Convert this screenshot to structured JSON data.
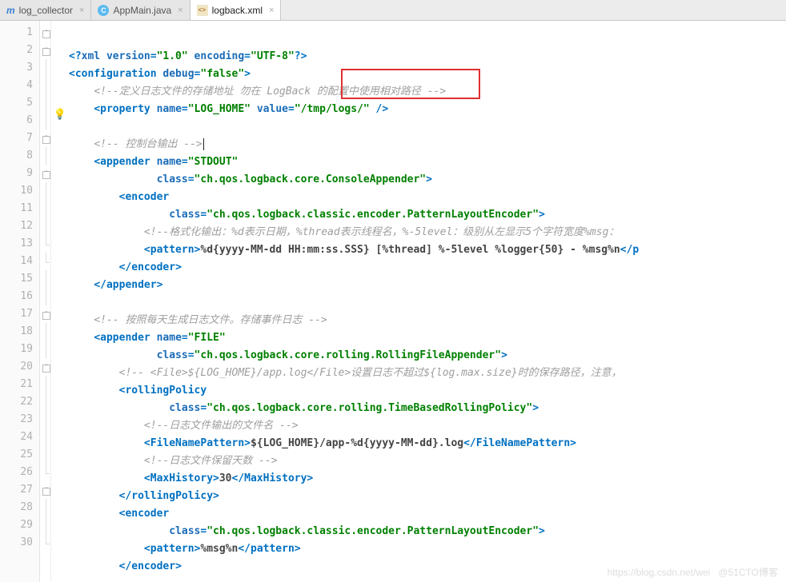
{
  "tabs": [
    {
      "icon": "m",
      "label": "log_collector",
      "active": false
    },
    {
      "icon": "j",
      "label": "AppMain.java",
      "active": false
    },
    {
      "icon": "x",
      "label": "logback.xml",
      "active": true
    }
  ],
  "highlight_value": "\"/tmp/logs/\"",
  "code": [
    {
      "n": "1",
      "fold": "top",
      "bulb": "",
      "spans": [
        {
          "c": "tag",
          "t": "<?"
        },
        {
          "c": "attr",
          "t": "xml version"
        },
        {
          "c": "tag",
          "t": "="
        },
        {
          "c": "str",
          "t": "\"1.0\""
        },
        {
          "c": "tag",
          "t": " "
        },
        {
          "c": "attr",
          "t": "encoding"
        },
        {
          "c": "tag",
          "t": "="
        },
        {
          "c": "str",
          "t": "\"UTF-8\""
        },
        {
          "c": "tag",
          "t": "?>"
        }
      ]
    },
    {
      "n": "2",
      "fold": "top",
      "bulb": "",
      "spans": [
        {
          "c": "tag",
          "t": "<configuration "
        },
        {
          "c": "attr",
          "t": "debug"
        },
        {
          "c": "tag",
          "t": "="
        },
        {
          "c": "str",
          "t": "\"false\""
        },
        {
          "c": "tag",
          "t": ">"
        }
      ]
    },
    {
      "n": "3",
      "fold": "line",
      "bulb": "",
      "spans": [
        {
          "c": "",
          "t": "    "
        },
        {
          "c": "cmt",
          "t": "<!--定义日志文件的存储地址 勿在 LogBack 的配置中使用相对路径 -->"
        }
      ]
    },
    {
      "n": "4",
      "fold": "line",
      "bulb": "",
      "spans": [
        {
          "c": "",
          "t": "    "
        },
        {
          "c": "tag",
          "t": "<property "
        },
        {
          "c": "attr",
          "t": "name"
        },
        {
          "c": "tag",
          "t": "="
        },
        {
          "c": "str",
          "t": "\"LOG_HOME\""
        },
        {
          "c": "tag",
          "t": " "
        },
        {
          "c": "attr",
          "t": "value"
        },
        {
          "c": "tag",
          "t": "="
        },
        {
          "c": "str",
          "t": "\"/tmp/logs/\""
        },
        {
          "c": "tag",
          "t": " />"
        }
      ]
    },
    {
      "n": "5",
      "fold": "line",
      "bulb": "",
      "spans": [
        {
          "c": "",
          "t": " "
        }
      ]
    },
    {
      "n": "6",
      "fold": "line",
      "bulb": "bulb",
      "spans": [
        {
          "c": "",
          "t": "    "
        },
        {
          "c": "cmt",
          "t": "<!-- 控制台输出 -->"
        },
        {
          "c": "caret",
          "t": ""
        }
      ]
    },
    {
      "n": "7",
      "fold": "top",
      "bulb": "",
      "spans": [
        {
          "c": "",
          "t": "    "
        },
        {
          "c": "tag",
          "t": "<appender "
        },
        {
          "c": "attr",
          "t": "name"
        },
        {
          "c": "tag",
          "t": "="
        },
        {
          "c": "str",
          "t": "\"STDOUT\""
        }
      ]
    },
    {
      "n": "8",
      "fold": "line",
      "bulb": "",
      "spans": [
        {
          "c": "",
          "t": "              "
        },
        {
          "c": "attr",
          "t": "class"
        },
        {
          "c": "tag",
          "t": "="
        },
        {
          "c": "str",
          "t": "\"ch.qos.logback.core.ConsoleAppender\""
        },
        {
          "c": "tag",
          "t": ">"
        }
      ]
    },
    {
      "n": "9",
      "fold": "top",
      "bulb": "",
      "spans": [
        {
          "c": "",
          "t": "        "
        },
        {
          "c": "tag",
          "t": "<encoder"
        }
      ]
    },
    {
      "n": "10",
      "fold": "line",
      "bulb": "",
      "spans": [
        {
          "c": "",
          "t": "                "
        },
        {
          "c": "attr",
          "t": "class"
        },
        {
          "c": "tag",
          "t": "="
        },
        {
          "c": "str",
          "t": "\"ch.qos.logback.classic.encoder.PatternLayoutEncoder\""
        },
        {
          "c": "tag",
          "t": ">"
        }
      ]
    },
    {
      "n": "11",
      "fold": "line",
      "bulb": "",
      "spans": [
        {
          "c": "",
          "t": "            "
        },
        {
          "c": "cmt",
          "t": "<!--格式化输出：%d表示日期，%thread表示线程名，%-5level：级别从左显示5个字符宽度%msg："
        }
      ]
    },
    {
      "n": "12",
      "fold": "line",
      "bulb": "",
      "spans": [
        {
          "c": "",
          "t": "            "
        },
        {
          "c": "tag",
          "t": "<pattern>"
        },
        {
          "c": "txt",
          "t": "%d{yyyy-MM-dd HH:mm:ss.SSS} [%thread] %-5level %logger{50} - %msg%n"
        },
        {
          "c": "tag",
          "t": "</p"
        }
      ]
    },
    {
      "n": "13",
      "fold": "bot",
      "bulb": "",
      "spans": [
        {
          "c": "",
          "t": "        "
        },
        {
          "c": "tag",
          "t": "</encoder>"
        }
      ]
    },
    {
      "n": "14",
      "fold": "bot",
      "bulb": "",
      "spans": [
        {
          "c": "",
          "t": "    "
        },
        {
          "c": "tag",
          "t": "</appender>"
        }
      ]
    },
    {
      "n": "15",
      "fold": "line",
      "bulb": "",
      "spans": [
        {
          "c": "",
          "t": " "
        }
      ]
    },
    {
      "n": "16",
      "fold": "line",
      "bulb": "",
      "spans": [
        {
          "c": "",
          "t": "    "
        },
        {
          "c": "cmt",
          "t": "<!-- 按照每天生成日志文件。存储事件日志 -->"
        }
      ]
    },
    {
      "n": "17",
      "fold": "top",
      "bulb": "",
      "spans": [
        {
          "c": "",
          "t": "    "
        },
        {
          "c": "tag",
          "t": "<appender "
        },
        {
          "c": "attr",
          "t": "name"
        },
        {
          "c": "tag",
          "t": "="
        },
        {
          "c": "str",
          "t": "\"FILE\""
        }
      ]
    },
    {
      "n": "18",
      "fold": "line",
      "bulb": "",
      "spans": [
        {
          "c": "",
          "t": "              "
        },
        {
          "c": "attr",
          "t": "class"
        },
        {
          "c": "tag",
          "t": "="
        },
        {
          "c": "str",
          "t": "\"ch.qos.logback.core.rolling.RollingFileAppender\""
        },
        {
          "c": "tag",
          "t": ">"
        }
      ]
    },
    {
      "n": "19",
      "fold": "line",
      "bulb": "",
      "spans": [
        {
          "c": "",
          "t": "        "
        },
        {
          "c": "cmt",
          "t": "<!-- <File>${LOG_HOME}/app.log</File>设置日志不超过${log.max.size}时的保存路径，注意，"
        }
      ]
    },
    {
      "n": "20",
      "fold": "top",
      "bulb": "",
      "spans": [
        {
          "c": "",
          "t": "        "
        },
        {
          "c": "tag",
          "t": "<rollingPolicy"
        }
      ]
    },
    {
      "n": "21",
      "fold": "line",
      "bulb": "",
      "spans": [
        {
          "c": "",
          "t": "                "
        },
        {
          "c": "attr",
          "t": "class"
        },
        {
          "c": "tag",
          "t": "="
        },
        {
          "c": "str",
          "t": "\"ch.qos.logback.core.rolling.TimeBasedRollingPolicy\""
        },
        {
          "c": "tag",
          "t": ">"
        }
      ]
    },
    {
      "n": "22",
      "fold": "line",
      "bulb": "",
      "spans": [
        {
          "c": "",
          "t": "            "
        },
        {
          "c": "cmt",
          "t": "<!--日志文件输出的文件名 -->"
        }
      ]
    },
    {
      "n": "23",
      "fold": "line",
      "bulb": "",
      "spans": [
        {
          "c": "",
          "t": "            "
        },
        {
          "c": "tag",
          "t": "<FileNamePattern>"
        },
        {
          "c": "txt",
          "t": "${LOG_HOME}/app-%d{yyyy-MM-dd}.log"
        },
        {
          "c": "tag",
          "t": "</FileNamePattern>"
        }
      ]
    },
    {
      "n": "24",
      "fold": "line",
      "bulb": "",
      "spans": [
        {
          "c": "",
          "t": "            "
        },
        {
          "c": "cmt",
          "t": "<!--日志文件保留天数 -->"
        }
      ]
    },
    {
      "n": "25",
      "fold": "line",
      "bulb": "",
      "spans": [
        {
          "c": "",
          "t": "            "
        },
        {
          "c": "tag",
          "t": "<MaxHistory>"
        },
        {
          "c": "txt",
          "t": "30"
        },
        {
          "c": "tag",
          "t": "</MaxHistory>"
        }
      ]
    },
    {
      "n": "26",
      "fold": "bot",
      "bulb": "",
      "spans": [
        {
          "c": "",
          "t": "        "
        },
        {
          "c": "tag",
          "t": "</rollingPolicy>"
        }
      ]
    },
    {
      "n": "27",
      "fold": "top",
      "bulb": "",
      "spans": [
        {
          "c": "",
          "t": "        "
        },
        {
          "c": "tag",
          "t": "<encoder"
        }
      ]
    },
    {
      "n": "28",
      "fold": "line",
      "bulb": "",
      "spans": [
        {
          "c": "",
          "t": "                "
        },
        {
          "c": "attr",
          "t": "class"
        },
        {
          "c": "tag",
          "t": "="
        },
        {
          "c": "str",
          "t": "\"ch.qos.logback.classic.encoder.PatternLayoutEncoder\""
        },
        {
          "c": "tag",
          "t": ">"
        }
      ]
    },
    {
      "n": "29",
      "fold": "line",
      "bulb": "",
      "spans": [
        {
          "c": "",
          "t": "            "
        },
        {
          "c": "tag",
          "t": "<pattern>"
        },
        {
          "c": "txt",
          "t": "%msg%n"
        },
        {
          "c": "tag",
          "t": "</pattern>"
        }
      ]
    },
    {
      "n": "30",
      "fold": "bot",
      "bulb": "",
      "spans": [
        {
          "c": "",
          "t": "        "
        },
        {
          "c": "tag",
          "t": "</encoder>"
        }
      ]
    }
  ],
  "watermark": "https://blog.csdn.net/wei   @51CTO博客"
}
